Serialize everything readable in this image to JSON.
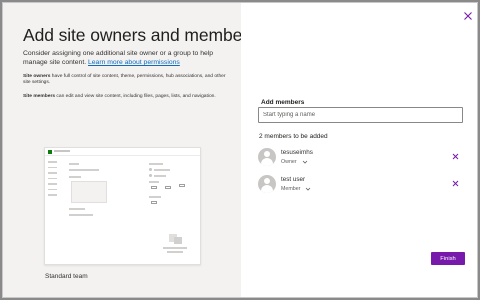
{
  "dialog": {
    "title": "Add site owners and members",
    "intro_text": "Consider assigning one additional site owner or a group to help manage site content. ",
    "intro_link": "Learn more about permissions",
    "owners_term": "Site owners",
    "owners_text": " have full control of site content, theme, permissions, hub associations, and other site settings.",
    "members_term": "Site members",
    "members_text": " can edit and view site content, including files, pages, lists, and navigation.",
    "template_label": "Standard team"
  },
  "members_panel": {
    "add_label": "Add members",
    "search_placeholder": "Start typing a name",
    "count_label": "2 members to be added",
    "members": [
      {
        "name": "tesuseimhs",
        "role": "Owner"
      },
      {
        "name": "test user",
        "role": "Member"
      }
    ]
  },
  "footer": {
    "finish_label": "Finish"
  },
  "colors": {
    "accent": "#7719aa",
    "link": "#0f6cbd",
    "left_panel_bg": "#f3f2f1",
    "remove_icon": "#7719aa"
  },
  "icons": {
    "close": "close-icon",
    "chevron": "chevron-down-icon",
    "remove": "remove-icon",
    "avatar": "person-avatar-icon"
  }
}
